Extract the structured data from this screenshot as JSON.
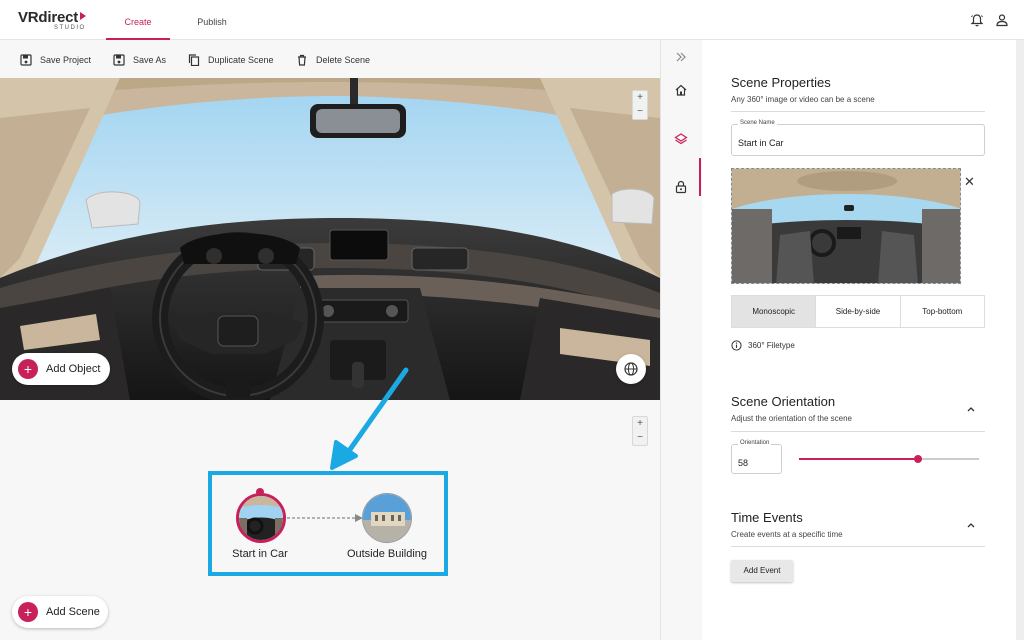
{
  "header": {
    "logo_main": "VRdirect",
    "logo_sub": "STUDIO",
    "tabs": [
      {
        "label": "Create",
        "active": true
      },
      {
        "label": "Publish",
        "active": false
      }
    ]
  },
  "toolbar": {
    "save_project": "Save Project",
    "save_as": "Save As",
    "duplicate_scene": "Duplicate Scene",
    "delete_scene": "Delete Scene"
  },
  "viewer": {
    "zoom_in": "+",
    "zoom_out": "−",
    "add_object": "Add Object"
  },
  "graph": {
    "zoom_in": "+",
    "zoom_out": "−",
    "nodes": [
      {
        "label": "Start in Car"
      },
      {
        "label": "Outside Building"
      }
    ],
    "add_scene": "Add Scene"
  },
  "scene_properties": {
    "title": "Scene Properties",
    "subtitle": "Any 360° image or video can be a scene",
    "name_label": "Scene Name",
    "name_value": "Start in Car",
    "close": "✕",
    "formats": [
      {
        "label": "Monoscopic",
        "selected": true
      },
      {
        "label": "Side-by-side",
        "selected": false
      },
      {
        "label": "Top-bottom",
        "selected": false
      }
    ],
    "filetype": "360° Filetype"
  },
  "orientation": {
    "title": "Scene Orientation",
    "subtitle": "Adjust the orientation of the scene",
    "label": "Orientation",
    "value": "58",
    "slider_fraction": 0.66
  },
  "time_events": {
    "title": "Time Events",
    "subtitle": "Create events at a specific time",
    "button": "Add Event"
  },
  "colors": {
    "accent": "#c8205a",
    "highlight": "#1ba9e3"
  }
}
